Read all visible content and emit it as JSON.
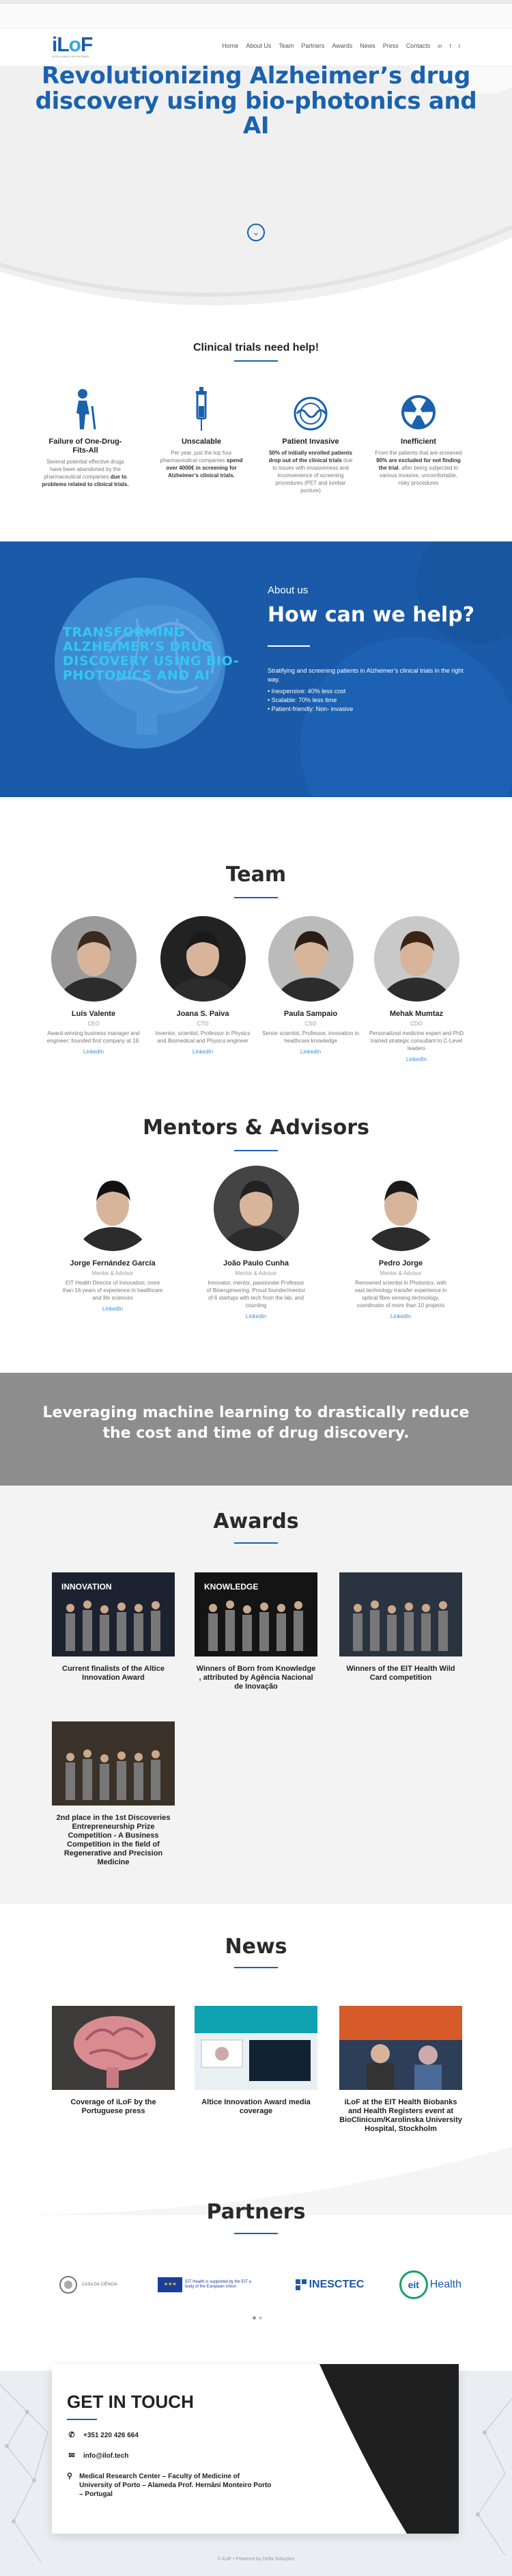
{
  "brand": {
    "logo_main": "iLoF",
    "logo_sub": "INTELLIGENT LAB ON FIBER"
  },
  "nav": {
    "items": [
      "Home",
      "About Us",
      "Team",
      "Partners",
      "Awards",
      "News",
      "Press",
      "Contacts"
    ],
    "social": [
      "in",
      "f",
      "t"
    ]
  },
  "hero": {
    "title": "Revolutionizing Alzheimer’s drug discovery using bio-photonics and AI",
    "scroll_icon": "chevron-down-icon"
  },
  "trials": {
    "title": "Clinical trials need help!",
    "items": [
      {
        "icon": "elderly-person-icon",
        "title": "Failure of One-Drug-Fits-All",
        "text": "Several potential effective drugs have been abandoned by the pharmaceutical companies ",
        "bold": "due to problems related to clinical trials."
      },
      {
        "icon": "syringe-icon",
        "title": "Unscalable",
        "text": "Per year, just the top four pharmaceutical companies ",
        "bold": "spend over 4000€ in screening for Alzheimer’s clinical trials."
      },
      {
        "icon": "injection-wave-icon",
        "title": "Patient Invasive",
        "bold": "50% of initially enrolled patients drop out of the clinical trials",
        "text": " due to issues with invasiveness and inconvenience of screening procedures (PET and lumbar punture)"
      },
      {
        "icon": "radiation-icon",
        "title": "Inefficient",
        "text": "From the patients that are screened ",
        "bold": "80% are excluded for not finding the trial",
        "text2": ", after being subjected to various invasive, uncomfortable, risky procedures"
      }
    ]
  },
  "about": {
    "circle_text": "TRANSFORMING ALZHEIMER’S DRUG DISCOVERY USING BIO-PHOTONICS AND AI",
    "kicker": "About us",
    "title": "How can we help?",
    "body": "Stratifying and screening patients in Alzheimer’s clinical trials in the right way.",
    "bullets": [
      "• Inexpensive: 40% less cost",
      "• Scalable: 70% less time",
      "• Patient-friendly: Non- invasive"
    ]
  },
  "team": {
    "title": "Team",
    "members": [
      {
        "name": "Luís Valente",
        "role": "CEO",
        "bio": "Award-winning business manager and engineer; founded first company at 18.",
        "link": "LinkedIn"
      },
      {
        "name": "Joana S. Paiva",
        "role": "CTO",
        "bio": "Inventor, scientist, Professor in Physics and Biomedical and Physics engineer",
        "link": "LinkedIn"
      },
      {
        "name": "Paula Sampaio",
        "role": "CSO",
        "bio": "Senior scientist, Professor, innovation in healthcare knowledge",
        "link": "LinkedIn"
      },
      {
        "name": "Mehak Mumtaz",
        "role": "CDO",
        "bio": "Personalized medicine expert and PhD trained strategic consultant to C-Level leaders",
        "link": "LinkedIn"
      }
    ]
  },
  "mentors": {
    "title": "Mentors & Advisors",
    "members": [
      {
        "name": "Jorge Fernández García",
        "role": "Mentor & Advisor",
        "bio": "EIT Health Director of Innovation; more than 16 years of experience in healthcare and life sciences",
        "link": "LinkedIn"
      },
      {
        "name": "João Paulo Cunha",
        "role": "Mentor & Advisor",
        "bio": "Innovator, mentor, passionate Professor of Bioengineering. Proud founder/mentor of 6 startups with tech from the lab, and counting",
        "link": "LinkedIn"
      },
      {
        "name": "Pedro Jorge",
        "role": "Mentor & Advisor",
        "bio": "Renowned scientist in Photonics, with vast technology transfer experience in optical fibre sensing technology, coordinator of more than 10 projects",
        "link": "LinkedIn"
      }
    ]
  },
  "banner": {
    "text": "Leveraging machine learning to drastically reduce the cost and time of drug discovery."
  },
  "awards": {
    "title": "Awards",
    "items": [
      {
        "caption": "Current finalists of the Altice Innovation Award",
        "img_text": "INNOVATION"
      },
      {
        "caption": "Winners of Born from Knowledge , attributed by Agência Nacional de Inovação",
        "img_text": "KNOWLEDGE"
      },
      {
        "caption": "Winners of the EIT Health Wild Card competition",
        "img_text": ""
      },
      {
        "caption": "2nd place in the 1st Discoveries Entrepreneurship Prize Competition - A Business Competition in the field of Regenerative and Precision Medicine",
        "img_text": ""
      }
    ]
  },
  "news": {
    "title": "News",
    "items": [
      {
        "caption": "Coverage of iLoF by the Portuguese press"
      },
      {
        "caption": "Altice Innovation Award media coverage"
      },
      {
        "caption": "iLoF at the EIT Health Biobanks and Health Registers event at BioClinicum/Karolinska University Hospital, Stockholm"
      }
    ]
  },
  "partners": {
    "title": "Partners",
    "logos": [
      {
        "name": "casa-da-ciencia-logo",
        "text": "CASA DA CIÊNCIA"
      },
      {
        "name": "eu-logo",
        "text": "EIT Health is supported by the EIT a body of the European Union"
      },
      {
        "name": "inesctec-logo",
        "text": "INESCTEC"
      },
      {
        "name": "eit-health-logo",
        "text": "Health"
      }
    ]
  },
  "contact": {
    "title": "GET IN TOUCH",
    "phone": "+351 220 426 664",
    "email": "info@ilof.tech",
    "address": "Medical Research Center – Faculty of Medicine of University of Porto – Alameda Prof. Hernâni Monteiro Porto – Portugal"
  },
  "footer": {
    "text": "© iLoF • Powered by Delta Soluções"
  }
}
